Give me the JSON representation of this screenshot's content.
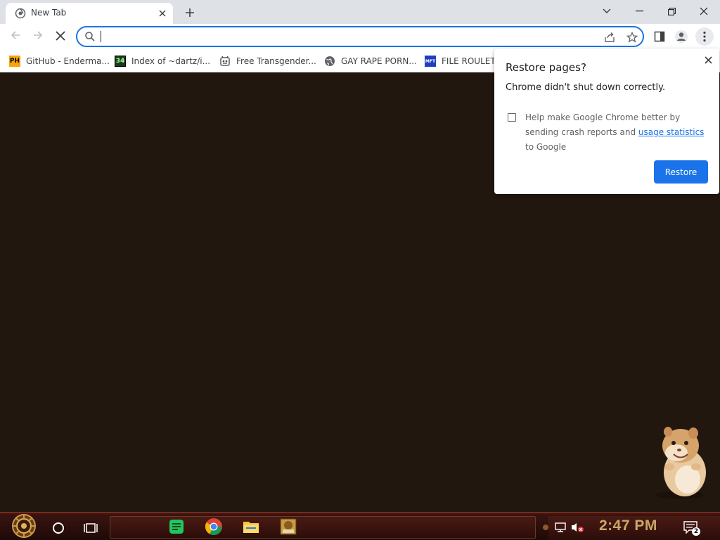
{
  "tab": {
    "title": "New Tab"
  },
  "omnibox": {
    "value": "",
    "placeholder": ""
  },
  "bookmarks": [
    {
      "label": "GitHub - Enderma...",
      "icon": "PH"
    },
    {
      "label": "Index of ~dartz/i...",
      "icon": "34"
    },
    {
      "label": "Free Transgender...",
      "icon": ""
    },
    {
      "label": "GAY RAPE PORN...",
      "icon": ""
    },
    {
      "label": "FILE ROULET",
      "icon": "MFT"
    }
  ],
  "restore_popup": {
    "title": "Restore pages?",
    "message": "Chrome didn't shut down correctly.",
    "help_text_before": "Help make Google Chrome better by sending crash reports and ",
    "help_link": "usage statistics",
    "help_text_after": " to Google",
    "checkbox_checked": false,
    "button_label": "Restore"
  },
  "taskbar": {
    "clock": "2:47 PM",
    "notification_count": "2"
  },
  "colors": {
    "accent": "#1a73e8",
    "page_background": "#22170f",
    "taskbar_clock": "#c9a867"
  }
}
